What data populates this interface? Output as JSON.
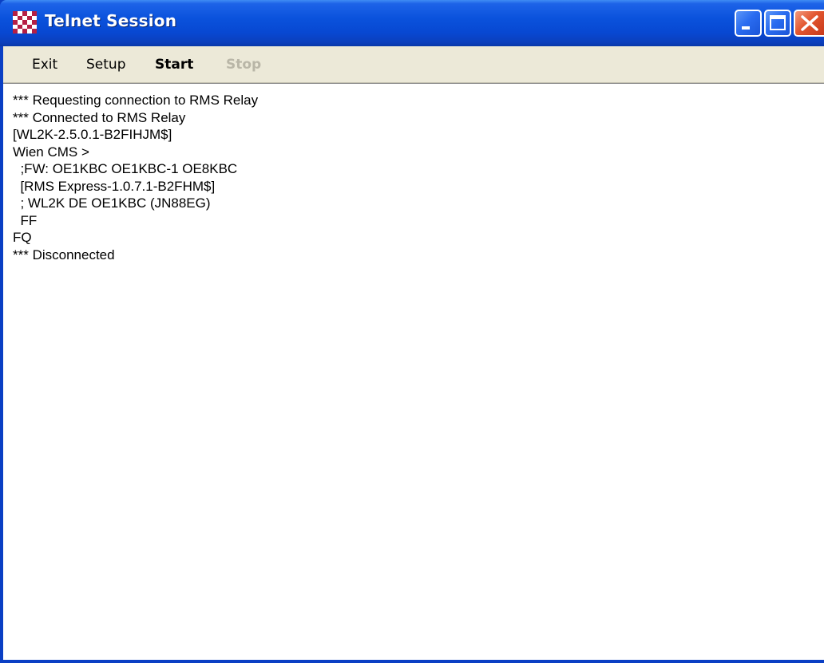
{
  "window": {
    "title": "Telnet Session",
    "app_icon": "checkerboard-icon",
    "controls": {
      "minimize_icon": "minimize-icon",
      "maximize_icon": "maximize-icon",
      "close_icon": "close-icon"
    }
  },
  "menu": {
    "items": [
      {
        "label": "Exit",
        "enabled": true
      },
      {
        "label": "Setup",
        "enabled": true
      },
      {
        "label": "Start",
        "enabled": true
      },
      {
        "label": "Stop",
        "enabled": false
      }
    ]
  },
  "log": {
    "lines": [
      "*** Requesting connection to RMS Relay",
      "*** Connected to RMS Relay",
      "[WL2K-2.5.0.1-B2FIHJM$]",
      "Wien CMS >",
      "  ;FW: OE1KBC OE1KBC-1 OE8KBC",
      "  [RMS Express-1.0.7.1-B2FHM$]",
      "  ; WL2K DE OE1KBC (JN88EG)",
      "  FF",
      "FQ",
      "*** Disconnected"
    ]
  },
  "colors": {
    "titlebar": "#0a52dc",
    "menubar": "#ece9d8",
    "disabled_text": "#b9b6a7",
    "close_button": "#e2562f",
    "icon_red": "#b51f45",
    "icon_white": "#ffffff"
  }
}
